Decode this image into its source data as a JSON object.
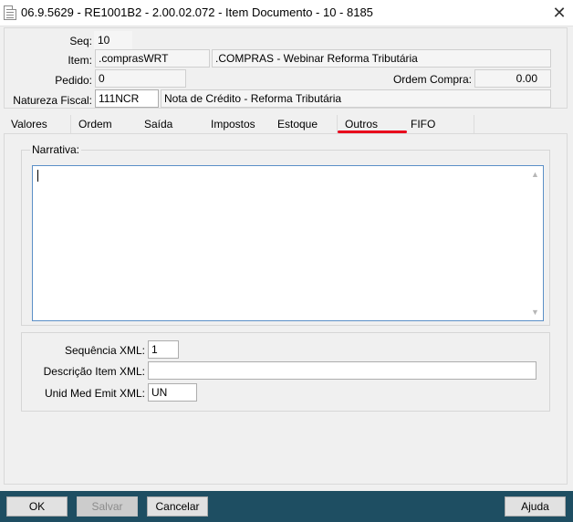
{
  "window": {
    "title": "06.9.5629 - RE1001B2 - 2.00.02.072 - Item Documento - 10 - 8185",
    "close_symbol": "✕"
  },
  "form": {
    "seq_label": "Seq:",
    "seq_value": "10",
    "item_label": "Item:",
    "item_code": ".comprasWRT",
    "item_desc": ".COMPRAS - Webinar Reforma Tributária",
    "pedido_label": "Pedido:",
    "pedido_value": "0",
    "ordem_compra_label": "Ordem Compra:",
    "ordem_compra_value": "0.00",
    "natureza_label": "Natureza Fiscal:",
    "natureza_code": "111NCR",
    "natureza_desc": "Nota de Crédito - Reforma Tributária"
  },
  "tabs": [
    {
      "label": "Valores"
    },
    {
      "label": "Ordem"
    },
    {
      "label": "Saída"
    },
    {
      "label": "Impostos"
    },
    {
      "label": "Estoque"
    },
    {
      "label": "Outros"
    },
    {
      "label": "FIFO"
    }
  ],
  "active_tab": "Outros",
  "active_tab_color": "#e8001c",
  "narrativa": {
    "label": "Narrativa:",
    "value": ""
  },
  "xml": {
    "sequencia_label": "Sequência XML:",
    "sequencia_value": "1",
    "descricao_label": "Descrição Item XML:",
    "descricao_value": "",
    "unid_label": "Unid Med Emit XML:",
    "unid_value": "UN"
  },
  "buttons": {
    "ok": "OK",
    "salvar": "Salvar",
    "cancelar": "Cancelar",
    "ajuda": "Ajuda"
  },
  "bottombar_color": "#1e4e62"
}
